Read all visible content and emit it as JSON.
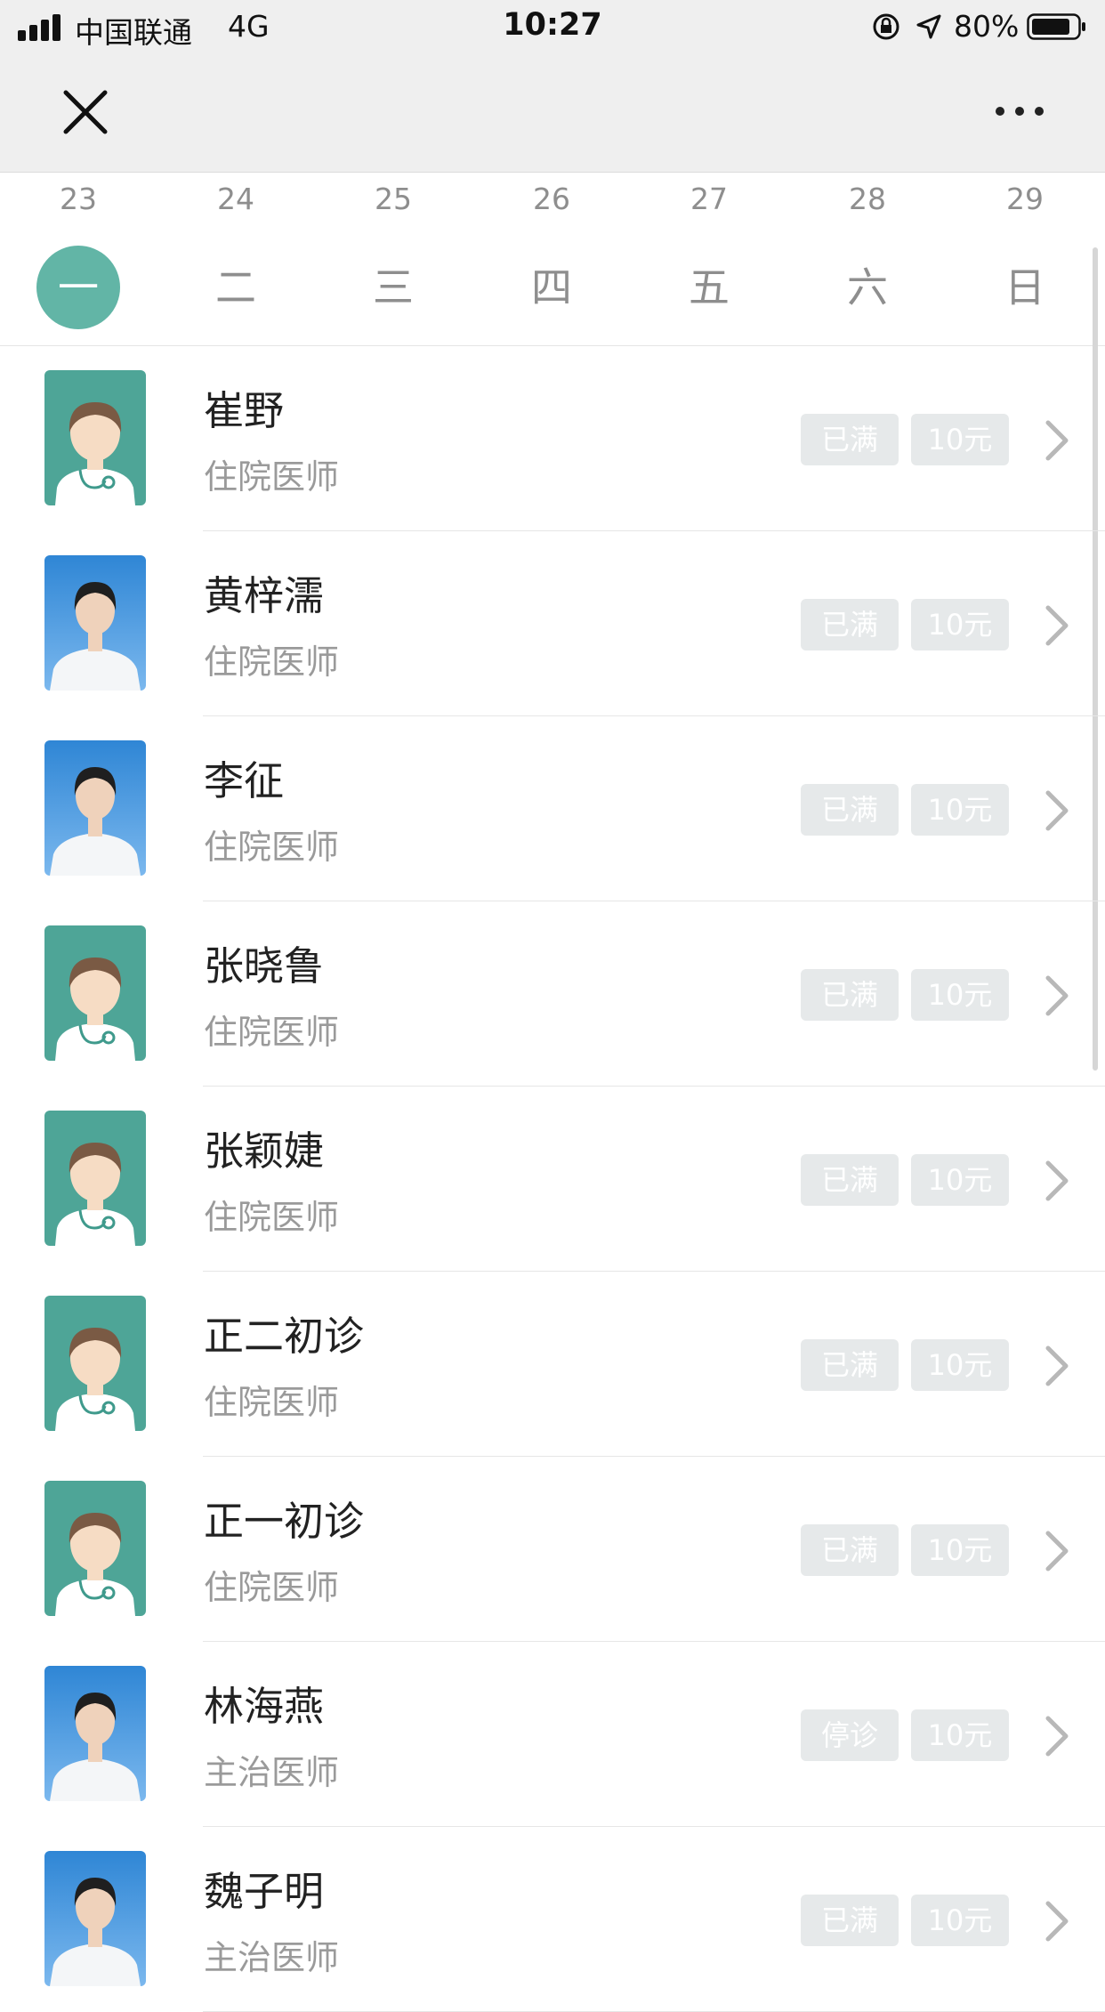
{
  "status_bar": {
    "carrier": "中国联通",
    "network": "4G",
    "time": "10:27",
    "battery": "80%",
    "icons": [
      "signal-icon",
      "orientation-lock-icon",
      "location-icon",
      "battery-icon"
    ]
  },
  "nav": {
    "icons": [
      "close-icon",
      "more-icon"
    ]
  },
  "week": {
    "days": [
      {
        "date": "23",
        "label": "一",
        "selected": true
      },
      {
        "date": "24",
        "label": "二"
      },
      {
        "date": "25",
        "label": "三"
      },
      {
        "date": "26",
        "label": "四"
      },
      {
        "date": "27",
        "label": "五"
      },
      {
        "date": "28",
        "label": "六"
      },
      {
        "date": "29",
        "label": "日"
      }
    ],
    "accent_color": "#62b5a6"
  },
  "doctors": [
    {
      "name": "崔野",
      "title": "住院医师",
      "status": "已满",
      "price": "10元",
      "avatar": "placeholder"
    },
    {
      "name": "黄梓濡",
      "title": "住院医师",
      "status": "已满",
      "price": "10元",
      "avatar": "photo"
    },
    {
      "name": "李征",
      "title": "住院医师",
      "status": "已满",
      "price": "10元",
      "avatar": "photo"
    },
    {
      "name": "张晓鲁",
      "title": "住院医师",
      "status": "已满",
      "price": "10元",
      "avatar": "placeholder"
    },
    {
      "name": "张颖婕",
      "title": "住院医师",
      "status": "已满",
      "price": "10元",
      "avatar": "placeholder"
    },
    {
      "name": "正二初诊",
      "title": "住院医师",
      "status": "已满",
      "price": "10元",
      "avatar": "placeholder"
    },
    {
      "name": "正一初诊",
      "title": "住院医师",
      "status": "已满",
      "price": "10元",
      "avatar": "placeholder"
    },
    {
      "name": "林海燕",
      "title": "主治医师",
      "status": "停诊",
      "price": "10元",
      "avatar": "photo"
    },
    {
      "name": "魏子明",
      "title": "主治医师",
      "status": "已满",
      "price": "10元",
      "avatar": "photo"
    }
  ]
}
